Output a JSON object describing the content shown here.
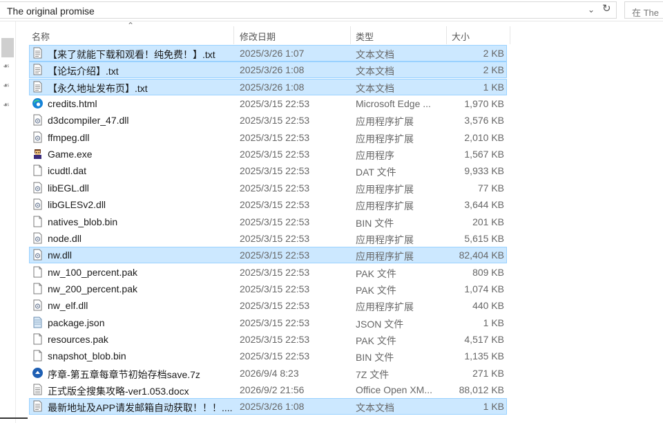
{
  "address": {
    "path": "The original promise",
    "search_placeholder": "在 The"
  },
  "columns": {
    "name": "名称",
    "date": "修改日期",
    "type": "类型",
    "size": "大小"
  },
  "files": [
    {
      "name": "【来了就能下载和观看！纯免费！】.txt",
      "date": "2025/3/26 1:07",
      "type": "文本文档",
      "size": "2 KB",
      "icon": "text-file-icon",
      "selected": true
    },
    {
      "name": "【论坛介绍】.txt",
      "date": "2025/3/26 1:08",
      "type": "文本文档",
      "size": "2 KB",
      "icon": "text-file-icon",
      "selected": true
    },
    {
      "name": "【永久地址发布页】.txt",
      "date": "2025/3/26 1:08",
      "type": "文本文档",
      "size": "1 KB",
      "icon": "text-file-icon",
      "selected": true
    },
    {
      "name": "credits.html",
      "date": "2025/3/15 22:53",
      "type": "Microsoft Edge ...",
      "size": "1,970 KB",
      "icon": "edge-icon",
      "selected": false
    },
    {
      "name": "d3dcompiler_47.dll",
      "date": "2025/3/15 22:53",
      "type": "应用程序扩展",
      "size": "3,576 KB",
      "icon": "dll-icon",
      "selected": false
    },
    {
      "name": "ffmpeg.dll",
      "date": "2025/3/15 22:53",
      "type": "应用程序扩展",
      "size": "2,010 KB",
      "icon": "dll-icon",
      "selected": false
    },
    {
      "name": "Game.exe",
      "date": "2025/3/15 22:53",
      "type": "应用程序",
      "size": "1,567 KB",
      "icon": "game-exe-icon",
      "selected": false
    },
    {
      "name": "icudtl.dat",
      "date": "2025/3/15 22:53",
      "type": "DAT 文件",
      "size": "9,933 KB",
      "icon": "blank-file-icon",
      "selected": false
    },
    {
      "name": "libEGL.dll",
      "date": "2025/3/15 22:53",
      "type": "应用程序扩展",
      "size": "77 KB",
      "icon": "dll-icon",
      "selected": false
    },
    {
      "name": "libGLESv2.dll",
      "date": "2025/3/15 22:53",
      "type": "应用程序扩展",
      "size": "3,644 KB",
      "icon": "dll-icon",
      "selected": false
    },
    {
      "name": "natives_blob.bin",
      "date": "2025/3/15 22:53",
      "type": "BIN 文件",
      "size": "201 KB",
      "icon": "blank-file-icon",
      "selected": false
    },
    {
      "name": "node.dll",
      "date": "2025/3/15 22:53",
      "type": "应用程序扩展",
      "size": "5,615 KB",
      "icon": "dll-icon",
      "selected": false
    },
    {
      "name": "nw.dll",
      "date": "2025/3/15 22:53",
      "type": "应用程序扩展",
      "size": "82,404 KB",
      "icon": "dll-icon",
      "selected": true
    },
    {
      "name": "nw_100_percent.pak",
      "date": "2025/3/15 22:53",
      "type": "PAK 文件",
      "size": "809 KB",
      "icon": "blank-file-icon",
      "selected": false
    },
    {
      "name": "nw_200_percent.pak",
      "date": "2025/3/15 22:53",
      "type": "PAK 文件",
      "size": "1,074 KB",
      "icon": "blank-file-icon",
      "selected": false
    },
    {
      "name": "nw_elf.dll",
      "date": "2025/3/15 22:53",
      "type": "应用程序扩展",
      "size": "440 KB",
      "icon": "dll-icon",
      "selected": false
    },
    {
      "name": "package.json",
      "date": "2025/3/15 22:53",
      "type": "JSON 文件",
      "size": "1 KB",
      "icon": "json-file-icon",
      "selected": false
    },
    {
      "name": "resources.pak",
      "date": "2025/3/15 22:53",
      "type": "PAK 文件",
      "size": "4,517 KB",
      "icon": "blank-file-icon",
      "selected": false
    },
    {
      "name": "snapshot_blob.bin",
      "date": "2025/3/15 22:53",
      "type": "BIN 文件",
      "size": "1,135 KB",
      "icon": "blank-file-icon",
      "selected": false
    },
    {
      "name": "序章-第五章每章节初始存档save.7z",
      "date": "2026/9/4 8:23",
      "type": "7Z 文件",
      "size": "271 KB",
      "icon": "archive-7z-icon",
      "selected": false
    },
    {
      "name": "正式版全搜集攻略-ver1.053.docx",
      "date": "2026/9/2 21:56",
      "type": "Office Open XM...",
      "size": "88,012 KB",
      "icon": "docx-file-icon",
      "selected": false
    },
    {
      "name": "最新地址及APP请发邮箱自动获取！！！....",
      "date": "2025/3/26 1:08",
      "type": "文本文档",
      "size": "1 KB",
      "icon": "text-file-icon",
      "selected": true
    }
  ],
  "colors": {
    "selection": "#cce8ff",
    "selection_border": "#99d1ff"
  }
}
